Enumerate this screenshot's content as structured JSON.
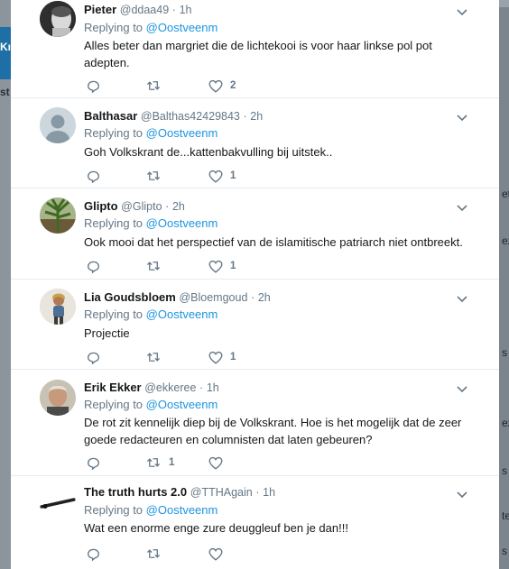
{
  "background": {
    "left_texts": [
      "Kı",
      "st"
    ],
    "right_texts": [
      "et",
      "ez",
      "s",
      "ez",
      "s",
      "ter",
      "s"
    ]
  },
  "tweets": [
    {
      "name": "Pieter",
      "handle": "@ddaa49",
      "time": "1h",
      "replying_prefix": "Replying to",
      "mention": "@Oostveenm",
      "text": "Alles beter dan margriet die de lichtekooi is voor haar linkse pol pot adepten.",
      "retweets": "",
      "likes": "2",
      "avatar": "pieter-avatar"
    },
    {
      "name": "Balthasar",
      "handle": "@Balthas42429843",
      "time": "2h",
      "replying_prefix": "Replying to",
      "mention": "@Oostveenm",
      "text": "Goh Volkskrant de...kattenbakvulling bij uitstek..",
      "retweets": "",
      "likes": "1",
      "avatar": "default-avatar"
    },
    {
      "name": "Glipto",
      "handle": "@Glipto",
      "time": "2h",
      "replying_prefix": "Replying to",
      "mention": "@Oostveenm",
      "text": "Ook mooi dat het perspectief van de islamitische patriarch niet ontbreekt.",
      "retweets": "",
      "likes": "1",
      "avatar": "plant-avatar"
    },
    {
      "name": "Lia Goudsbloem",
      "handle": "@Bloemgoud",
      "time": "2h",
      "replying_prefix": "Replying to",
      "mention": "@Oostveenm",
      "text": "Projectie",
      "retweets": "",
      "likes": "1",
      "avatar": "person-avatar"
    },
    {
      "name": "Erik Ekker",
      "handle": "@ekkeree",
      "time": "1h",
      "replying_prefix": "Replying to",
      "mention": "@Oostveenm",
      "text": "De rot zit kennelijk diep bij de Volkskrant. Hoe is het mogelijk dat de zeer goede redacteuren en columnisten dat laten gebeuren?",
      "retweets": "1",
      "likes": "",
      "avatar": "portrait-avatar"
    },
    {
      "name": "The truth hurts 2.0",
      "handle": "@TTHAgain",
      "time": "1h",
      "replying_prefix": "Replying to",
      "mention": "@Oostveenm",
      "text": "Wat een enorme enge zure deuggleuf ben je dan!!!",
      "retweets": "",
      "likes": "",
      "avatar": "object-avatar"
    }
  ],
  "colors": {
    "link": "#1b95e0",
    "secondary": "#657786",
    "text": "#14171a"
  },
  "icons": [
    "reply-icon",
    "retweet-icon",
    "like-icon",
    "chevron-down-icon"
  ]
}
